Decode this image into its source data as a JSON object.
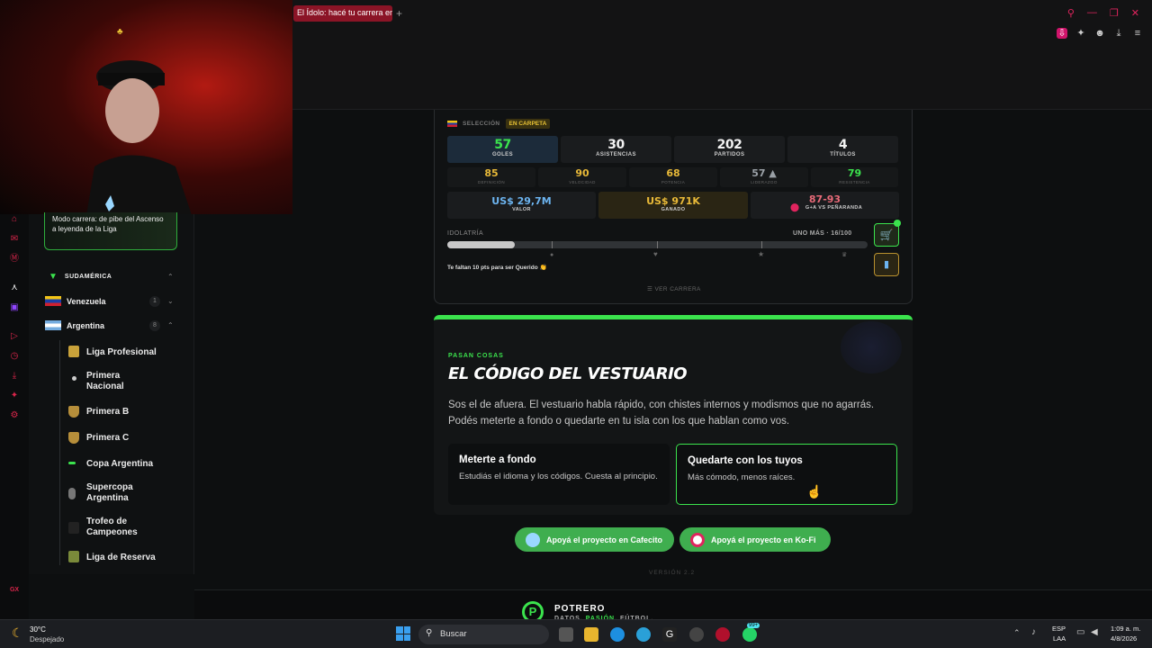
{
  "browser": {
    "tab_title": "El Ídolo: hacé tu carrera en",
    "tab_add": "+"
  },
  "sidebar": {
    "promo_text": "Modo carrera: de pibe del Ascenso a leyenda de la Liga",
    "region": "SUDAMÉRICA",
    "countries": [
      {
        "name": "Venezuela",
        "count": "1"
      },
      {
        "name": "Argentina",
        "count": "8"
      }
    ],
    "leagues": [
      {
        "name": "Liga Profesional"
      },
      {
        "name": "Primera Nacional"
      },
      {
        "name": "Primera B"
      },
      {
        "name": "Primera C"
      },
      {
        "name": "Copa Argentina"
      },
      {
        "name": "Supercopa Argentina"
      },
      {
        "name": "Trofeo de Campeones"
      },
      {
        "name": "Liga de Reserva"
      }
    ],
    "gx_label": "GX"
  },
  "career": {
    "selection_label": "SELECCIÓN",
    "selection_badge": "EN CARPETA",
    "main_stats": [
      {
        "value": "57",
        "label": "GOLES"
      },
      {
        "value": "30",
        "label": "ASISTENCIAS"
      },
      {
        "value": "202",
        "label": "PARTIDOS"
      },
      {
        "value": "4",
        "label": "TÍTULOS"
      }
    ],
    "attributes": [
      {
        "value": "85",
        "label": "DEFINICIÓN",
        "color": "#e8b938"
      },
      {
        "value": "90",
        "label": "VELOCIDAD",
        "color": "#e8b938"
      },
      {
        "value": "68",
        "label": "POTENCIA",
        "color": "#e8b938"
      },
      {
        "value": "57 ▲",
        "label": "LIDERAZGO",
        "color": "#9aa0a6"
      },
      {
        "value": "79",
        "label": "RESISTENCIA",
        "color": "#3be34d"
      }
    ],
    "value_amount": "US$ 29,7M",
    "value_label": "VALOR",
    "earned_amount": "US$ 971K",
    "earned_label": "GANADO",
    "record_score": "87-93",
    "record_label": "G+A VS PEÑARANDA",
    "idolatry_label": "IDOLATRÍA",
    "idolatry_status": "UNO MÁS · 16/100",
    "idolatry_progress": 0.16,
    "points_hint": "Te faltan 10 pts para ser Querido 👏",
    "view_career": "VER CARRERA"
  },
  "code_card": {
    "kicker": "PASAN COSAS",
    "title": "EL CÓDIGO DEL VESTUARIO",
    "body": "Sos el de afuera. El vestuario habla rápido, con chistes internos y modismos que no agarrás. Podés meterte a fondo o quedarte en tu isla con los que hablan como vos.",
    "options": [
      {
        "title": "Meterte a fondo",
        "desc": "Estudiás el idioma y los códigos. Cuesta al principio."
      },
      {
        "title": "Quedarte con los tuyos",
        "desc": "Más cómodo, menos raíces."
      }
    ]
  },
  "support": {
    "cafecito": "Apoyá el proyecto en Cafecito",
    "kofi": "Apoyá el proyecto en Ko-Fi"
  },
  "version": "VERSIÓN 2.2",
  "footer": {
    "brand": "POTRERO",
    "tagline_a": "DATOS.",
    "tagline_b": "PASIÓN.",
    "tagline_c": "FÚTBOL."
  },
  "taskbar": {
    "weather_temp": "30°C",
    "weather_desc": "Despejado",
    "search_placeholder": "Buscar",
    "lang_top": "ESP",
    "lang_bottom": "LAA",
    "time": "1:09 a. m.",
    "date": "4/8/2026",
    "badge_count": "99+"
  }
}
